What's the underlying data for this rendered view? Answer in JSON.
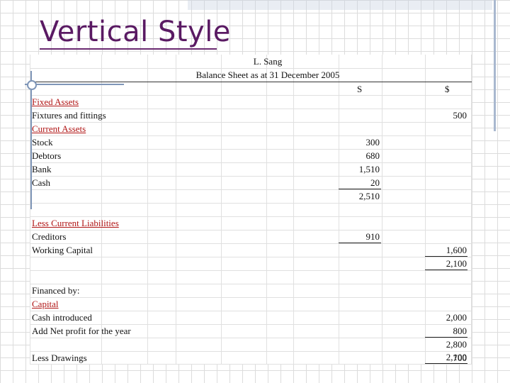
{
  "title": "Vertical Style",
  "sheet": {
    "company": "L. Sang",
    "statement": "Balance Sheet as at 31 December 2005",
    "header_s": "S",
    "header_d": "$",
    "fixed_assets_label": "Fixed Assets",
    "fixtures_label": "Fixtures and fittings",
    "fixtures_value": "500",
    "current_assets_label": "Current Assets",
    "stock_label": "Stock",
    "stock_value": "300",
    "debtors_label": "Debtors",
    "debtors_value": "680",
    "bank_label": "Bank",
    "bank_value": "1,510",
    "cash_label": "Cash",
    "cash_value": "20",
    "current_total": "2,510",
    "less_cl_label": "Less Current Liabilities",
    "creditors_label": "Creditors",
    "creditors_value": "910",
    "working_capital_label": "Working Capital",
    "working_capital_value": "1,600",
    "net_total": "2,100",
    "financed_by_label": "Financed by:",
    "capital_label": "Capital",
    "cash_introduced_label": "Cash introduced",
    "cash_introduced_value": "2,000",
    "net_profit_label": "Add Net profit for the year",
    "net_profit_value": "800",
    "subtotal": "2,800",
    "drawings_label": "Less Drawings",
    "drawings_value": "700",
    "final_total": "2,100"
  }
}
